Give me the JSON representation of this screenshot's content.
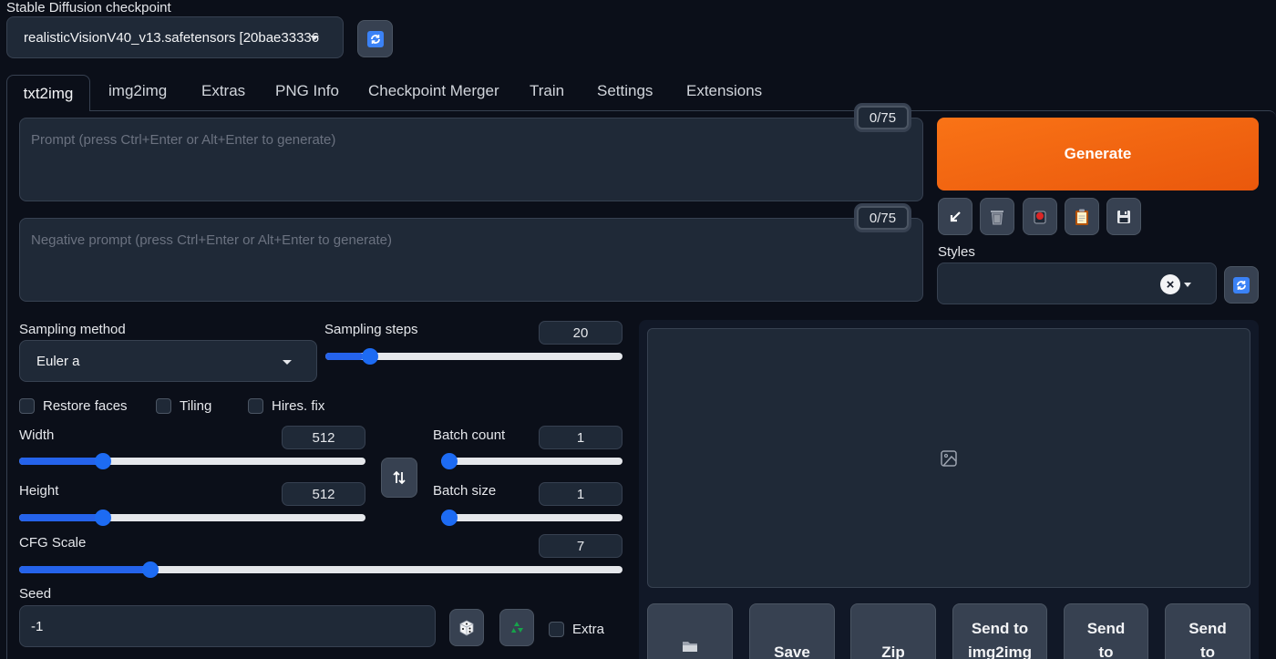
{
  "checkpoint": {
    "label": "Stable Diffusion checkpoint",
    "value": "realisticVisionV40_v13.safetensors [20bae33336",
    "refresh_icon": "refresh-icon"
  },
  "tabs": [
    "txt2img",
    "img2img",
    "Extras",
    "PNG Info",
    "Checkpoint Merger",
    "Train",
    "Settings",
    "Extensions"
  ],
  "prompt": {
    "placeholder": "Prompt (press Ctrl+Enter or Alt+Enter to generate)",
    "counter": "0/75"
  },
  "negative_prompt": {
    "placeholder": "Negative prompt (press Ctrl+Enter or Alt+Enter to generate)",
    "counter": "0/75"
  },
  "generate": {
    "label": "Generate",
    "color": "#f97316"
  },
  "tool_icons": [
    "arrow-down-left-icon",
    "trash-icon",
    "red-button-icon",
    "clipboard-icon",
    "floppy-disk-icon"
  ],
  "styles": {
    "label": "Styles"
  },
  "sampling": {
    "method_label": "Sampling method",
    "method_value": "Euler a",
    "steps_label": "Sampling steps",
    "steps_value": "20",
    "steps_fraction": 0.13
  },
  "checkboxes": {
    "restore_faces": "Restore faces",
    "tiling": "Tiling",
    "hires_fix": "Hires. fix"
  },
  "width": {
    "label": "Width",
    "value": "512",
    "fraction": 0.23
  },
  "height": {
    "label": "Height",
    "value": "512",
    "fraction": 0.23
  },
  "batch_count": {
    "label": "Batch count",
    "value": "1",
    "fraction": 0.0
  },
  "batch_size": {
    "label": "Batch size",
    "value": "1",
    "fraction": 0.0
  },
  "cfg": {
    "label": "CFG Scale",
    "value": "7",
    "fraction": 0.21
  },
  "seed": {
    "label": "Seed",
    "value": "-1",
    "extra_label": "Extra"
  },
  "output_buttons": {
    "save": "Save",
    "zip": "Zip",
    "send_img2img": "Send to img2img",
    "send_inpaint": "Send to",
    "send_extras": "Send to"
  },
  "accent_color": "#2563eb"
}
